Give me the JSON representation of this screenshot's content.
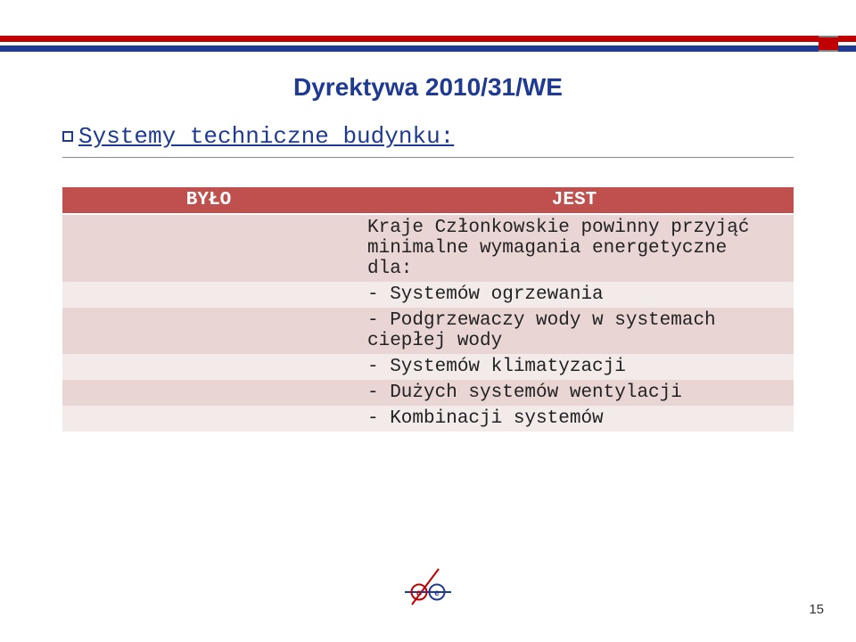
{
  "title": "Dyrektywa 2010/31/WE",
  "subtitle": "Systemy techniczne budynku:",
  "table": {
    "header_left": "BYŁO",
    "header_right": "JEST",
    "rows": [
      "Kraje Członkowskie powinny przyjąć minimalne wymagania energetyczne dla:",
      "- Systemów ogrzewania",
      "- Podgrzewaczy wody w systemach ciepłej wody",
      "- Systemów klimatyzacji",
      "- Dużych systemów wentylacji",
      "- Kombinacji systemów"
    ]
  },
  "page_number": "15"
}
